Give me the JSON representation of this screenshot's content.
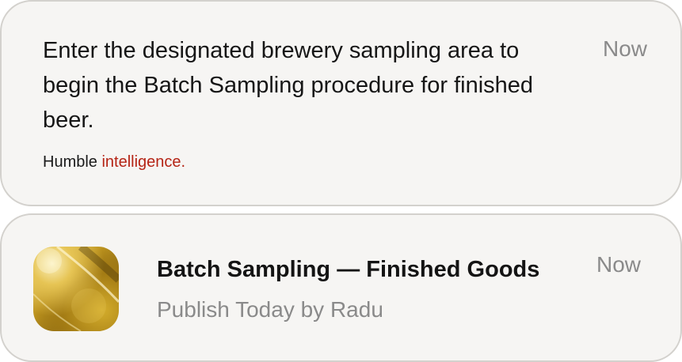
{
  "notification_1": {
    "message": "Enter the designated brewery sampling area to begin the Batch Sampling procedure for finished beer.",
    "time": "Now",
    "tagline_plain": "Humble",
    "tagline_accent": "intelligence."
  },
  "notification_2": {
    "title": "Batch Sampling — Finished Goods",
    "subtitle": "Publish Today by Radu",
    "time": "Now",
    "thumbnail_icon": "beer-glass-image"
  },
  "colors": {
    "card_background": "#f6f5f3",
    "card_border": "#d3d1cd",
    "accent": "#b52415",
    "muted_text": "#8a8a8a"
  }
}
